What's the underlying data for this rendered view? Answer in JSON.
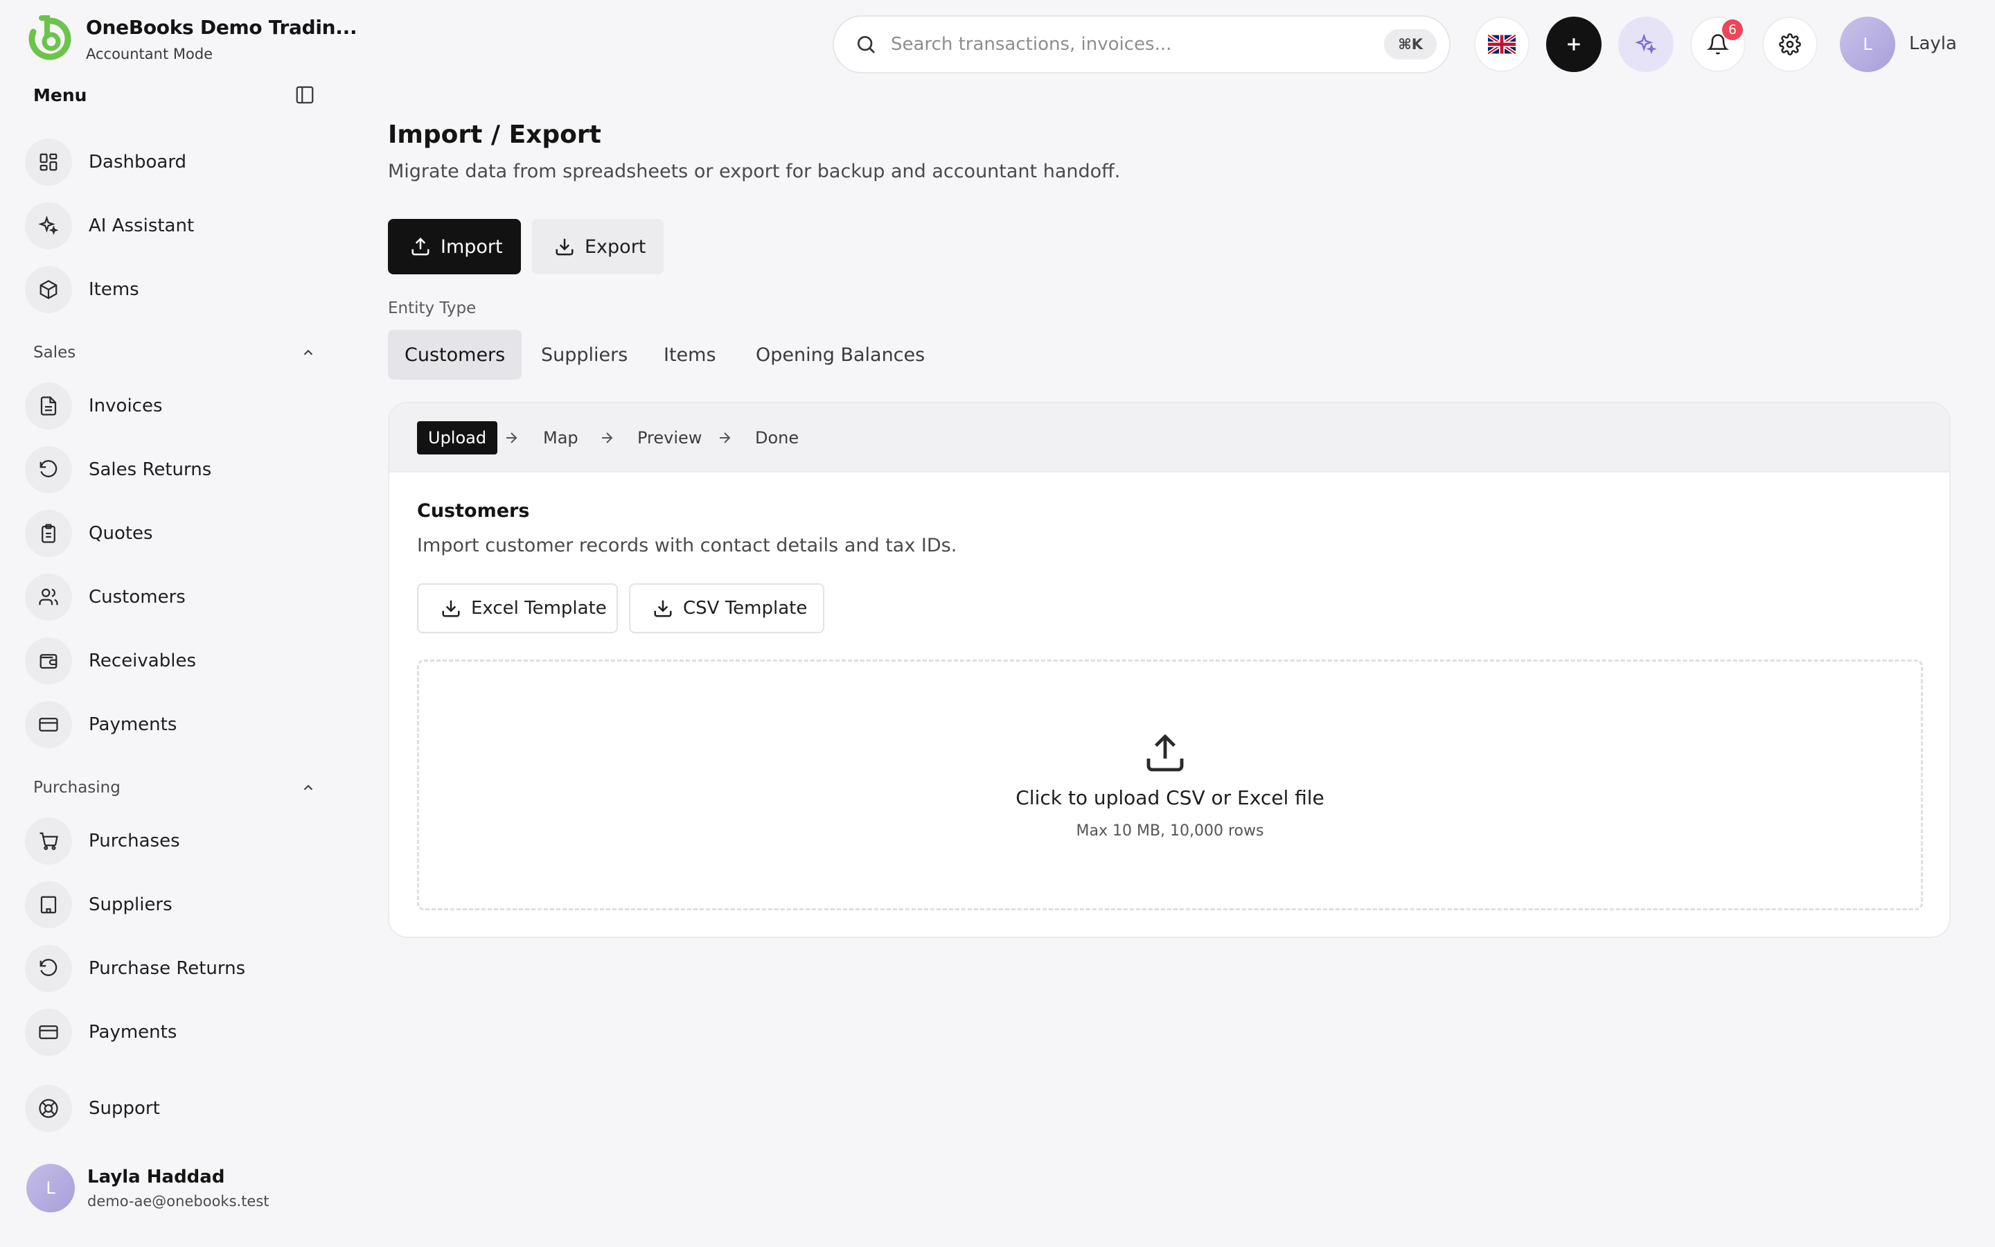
{
  "brand": {
    "name": "OneBooks Demo Tradin...",
    "mode": "Accountant Mode",
    "accent": "#6cc44a"
  },
  "sidebar": {
    "menu_title": "Menu",
    "top_items": [
      {
        "label": "Dashboard",
        "icon": "dashboard-icon"
      },
      {
        "label": "AI Assistant",
        "icon": "sparkles-icon"
      },
      {
        "label": "Items",
        "icon": "box-icon"
      }
    ],
    "sales": {
      "title": "Sales",
      "items": [
        {
          "label": "Invoices",
          "icon": "file-text-icon"
        },
        {
          "label": "Sales Returns",
          "icon": "rotate-ccw-icon"
        },
        {
          "label": "Quotes",
          "icon": "clipboard-icon"
        },
        {
          "label": "Customers",
          "icon": "users-icon"
        },
        {
          "label": "Receivables",
          "icon": "wallet-icon"
        },
        {
          "label": "Payments",
          "icon": "credit-card-icon"
        }
      ]
    },
    "purchasing": {
      "title": "Purchasing",
      "items": [
        {
          "label": "Purchases",
          "icon": "shopping-cart-icon"
        },
        {
          "label": "Suppliers",
          "icon": "building-icon"
        },
        {
          "label": "Purchase Returns",
          "icon": "rotate-ccw-icon"
        },
        {
          "label": "Payments",
          "icon": "credit-card-icon"
        }
      ]
    },
    "support": {
      "label": "Support",
      "icon": "life-buoy-icon"
    },
    "user": {
      "initial": "L",
      "name": "Layla Haddad",
      "email": "demo-ae@onebooks.test"
    }
  },
  "topbar": {
    "search_placeholder": "Search transactions, invoices...",
    "shortcut": "⌘K",
    "notification_count": "6",
    "user_initial": "L",
    "user_name": "Layla"
  },
  "main": {
    "title": "Import / Export",
    "subtitle": "Migrate data from spreadsheets or export for backup and accountant handoff.",
    "import_label": "Import",
    "export_label": "Export",
    "entity_type_label": "Entity Type",
    "tabs": [
      "Customers",
      "Suppliers",
      "Items",
      "Opening Balances"
    ],
    "active_tab": "Customers",
    "steps": [
      "Upload",
      "Map",
      "Preview",
      "Done"
    ],
    "active_step": "Upload",
    "card": {
      "title": "Customers",
      "description": "Import customer records with contact details and tax IDs.",
      "excel_template": "Excel Template",
      "csv_template": "CSV Template",
      "dropzone_title": "Click to upload CSV or Excel file",
      "dropzone_subtitle": "Max 10 MB, 10,000 rows"
    }
  }
}
